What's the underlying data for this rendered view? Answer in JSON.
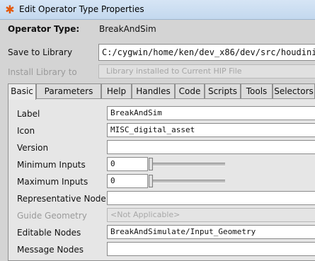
{
  "window": {
    "title": "Edit Operator Type Properties",
    "icon": "houdini-logo-icon"
  },
  "header": {
    "operator_type_label": "Operator Type:",
    "operator_type_value": "BreakAndSim",
    "save_to_library_label": "Save to Library",
    "save_to_library_value": "C:/cygwin/home/ken/dev_x86/dev/src/houdini/",
    "install_library_label": "Install Library to",
    "install_library_value": "Library installed to Current HIP File"
  },
  "tabs": [
    "Basic",
    "Parameters",
    "Help",
    "Handles",
    "Code",
    "Scripts",
    "Tools",
    "Selectors"
  ],
  "active_tab": "Basic",
  "basic": {
    "label_label": "Label",
    "label_value": "BreakAndSim",
    "icon_label": "Icon",
    "icon_value": "MISC_digital_asset",
    "version_label": "Version",
    "version_value": "",
    "min_inputs_label": "Minimum Inputs",
    "min_inputs_value": "0",
    "max_inputs_label": "Maximum Inputs",
    "max_inputs_value": "0",
    "representative_node_label": "Representative Node",
    "representative_node_value": "",
    "guide_geometry_label": "Guide Geometry",
    "guide_geometry_value": "<Not Applicable>",
    "editable_nodes_label": "Editable Nodes",
    "editable_nodes_value": "BreakAndSimulate/Input_Geometry",
    "message_nodes_label": "Message Nodes",
    "message_nodes_value": ""
  },
  "colors": {
    "titlebar": "#c9dcf0",
    "app_icon": "#e35a0e"
  }
}
